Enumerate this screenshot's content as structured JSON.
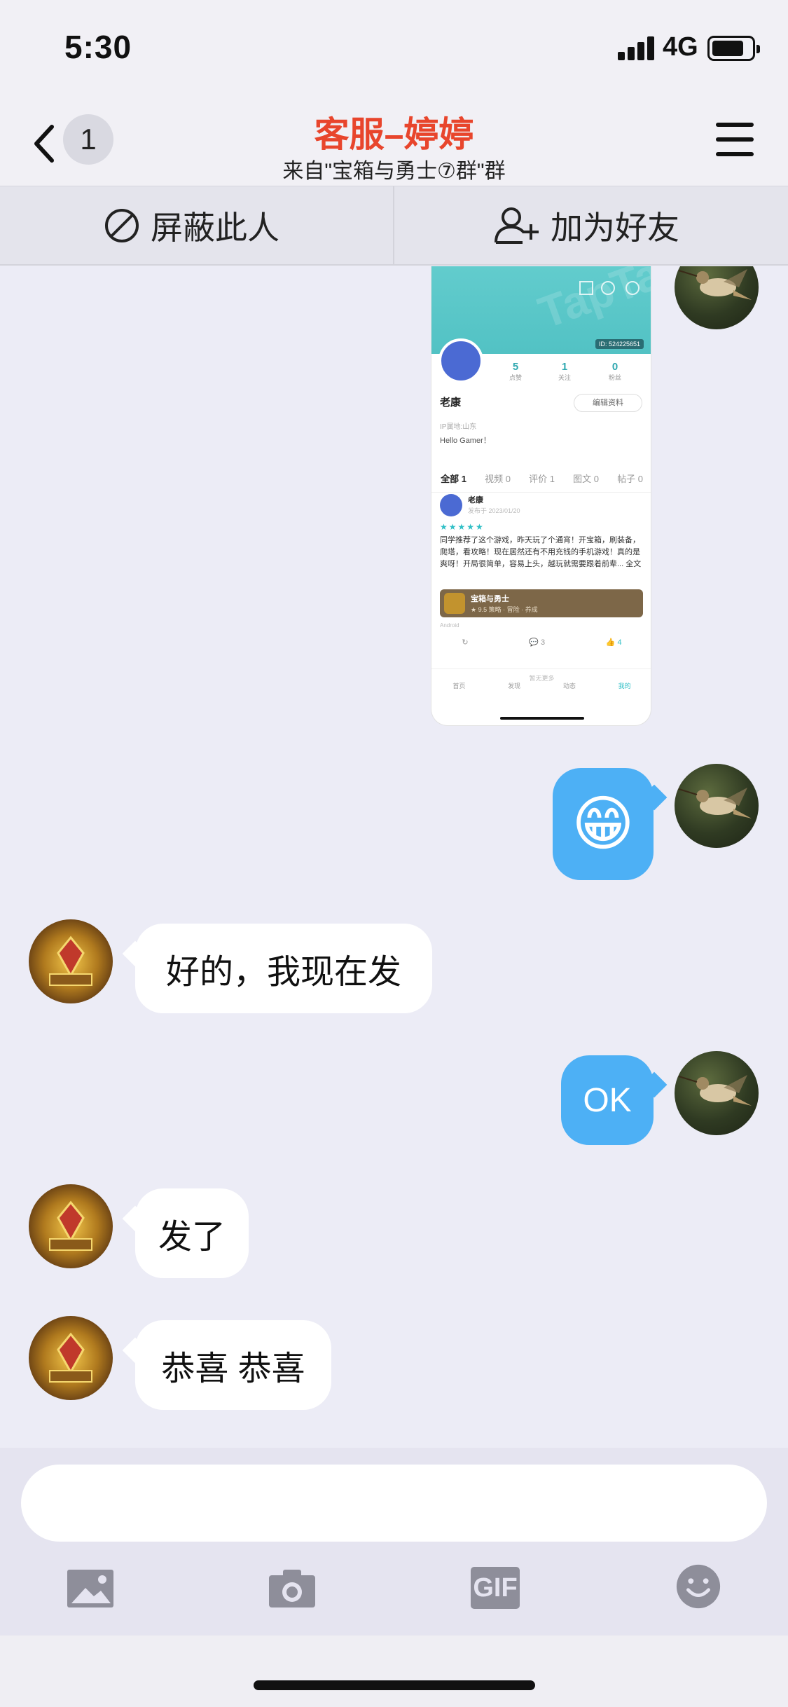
{
  "status_bar": {
    "time": "5:30",
    "network": "4G"
  },
  "nav": {
    "unread_count": "1",
    "title": "客服–婷婷",
    "subtitle": "来自\"宝箱与勇士⑦群\"群"
  },
  "actions": {
    "block_label": "屏蔽此人",
    "add_friend_label": "加为好友"
  },
  "screenshot_message": {
    "watermark": "TapTap",
    "id_label": "ID: 524225651",
    "stats": [
      {
        "value": "5",
        "label": "点赞"
      },
      {
        "value": "1",
        "label": "关注"
      },
      {
        "value": "0",
        "label": "粉丝"
      }
    ],
    "name": "老康",
    "edit_label": "编辑资料",
    "location": "IP属地:山东",
    "bio": "Hello Gamer！",
    "tabs": [
      "全部 1",
      "视频 0",
      "评价 1",
      "图文 0",
      "帖子 0"
    ],
    "post_author": "老康",
    "post_date": "发布于 2023/01/20",
    "post_stars": "★★★★★",
    "post_text": "同学推荐了这个游戏，昨天玩了个通宵！开宝箱，刷装备，爬塔，看攻略！现在居然还有不用充钱的手机游戏！真的是爽呀！开局很简单，容易上头，越玩就需要跟着前辈... 全文",
    "game_name": "宝箱与勇士",
    "game_meta": "★ 9.5 策略 · 冒险 · 养成",
    "platform": "Android",
    "comment_count": "3",
    "like_count": "4",
    "no_more": "暂无更多",
    "bottom_nav": [
      "首页",
      "发现",
      "动态",
      "我的"
    ]
  },
  "messages": [
    {
      "side": "right",
      "type": "emoji",
      "content": "😁"
    },
    {
      "side": "left",
      "type": "text",
      "content": "好的，我现在发"
    },
    {
      "side": "right",
      "type": "text",
      "content": "OK"
    },
    {
      "side": "left",
      "type": "text",
      "content": "发了"
    },
    {
      "side": "left",
      "type": "text",
      "content": "恭喜 恭喜"
    }
  ],
  "input": {
    "placeholder": ""
  },
  "toolbar": {
    "gif_label": "GIF"
  },
  "colors": {
    "title": "#E8452C",
    "outgoing_bubble": "#4DB0F5",
    "incoming_bubble": "#FFFFFF",
    "background": "#ECECF6"
  }
}
